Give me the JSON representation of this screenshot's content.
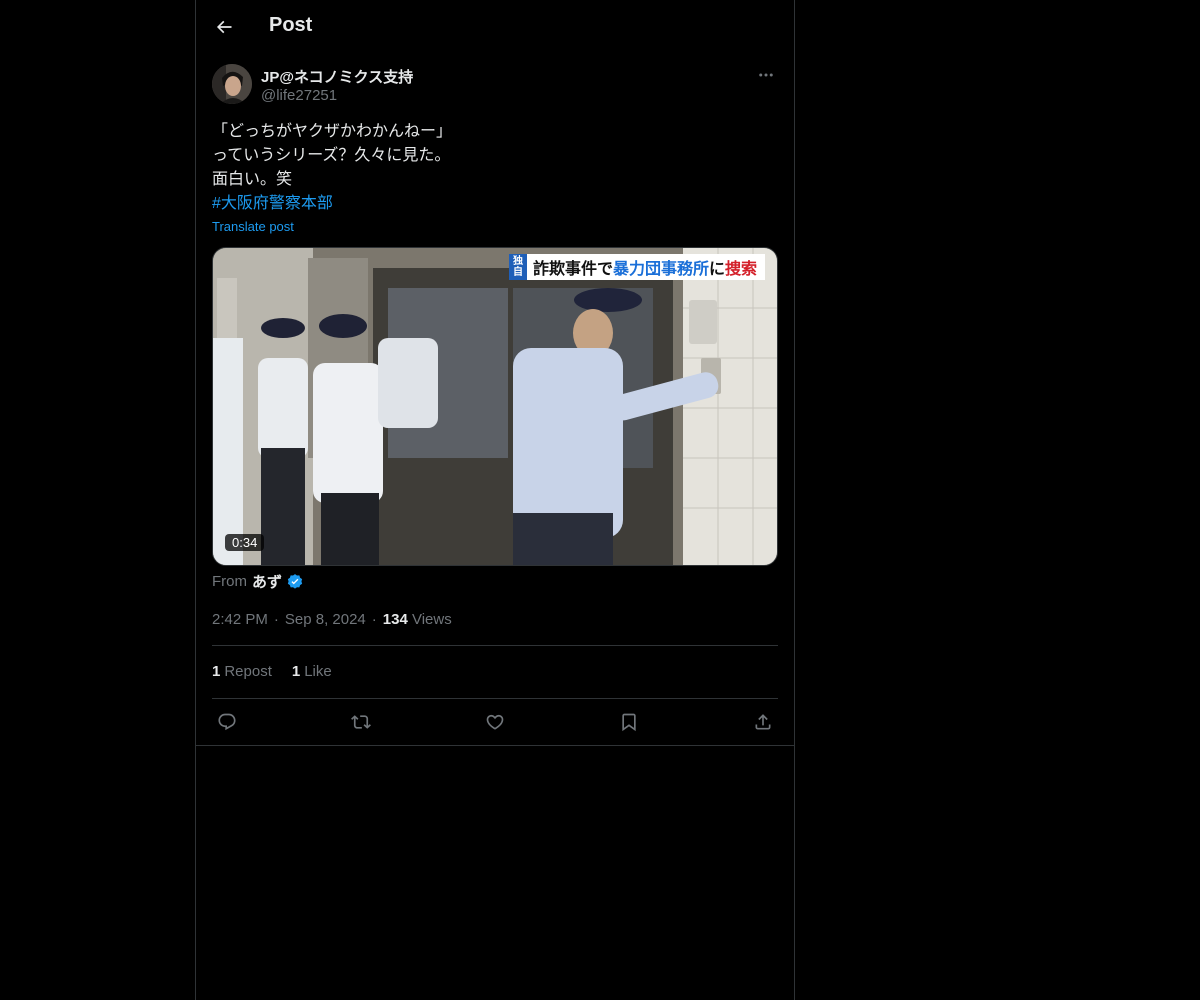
{
  "header": {
    "back_icon": "arrow-left-icon",
    "title": "Post"
  },
  "author": {
    "display_name": "JP@ネコノミクス支持",
    "handle": "@life27251",
    "more_icon": "more-horizontal-icon"
  },
  "post": {
    "lines": [
      "「どっちがヤクザかわかんねー」",
      "っていうシリーズ？久々に見た。",
      "面白い。笑"
    ],
    "hashtag": "#大阪府警察本部",
    "translate_label": "Translate post"
  },
  "media": {
    "caption_tag": [
      "独",
      "自"
    ],
    "caption_part1": "詐欺事件で",
    "caption_part2": "暴力団事務所",
    "caption_part3": "に",
    "caption_part4": "捜索",
    "duration": "0:34"
  },
  "attribution": {
    "from_label": "From",
    "source_name": "あず",
    "verified_icon": "verified-badge-icon"
  },
  "meta": {
    "time": "2:42 PM",
    "date": "Sep 8, 2024",
    "views_count": "134",
    "views_label": "Views"
  },
  "stats": {
    "reposts_count": "1",
    "reposts_label": "Repost",
    "likes_count": "1",
    "likes_label": "Like"
  },
  "actions": {
    "reply_icon": "reply-icon",
    "repost_icon": "repost-icon",
    "like_icon": "heart-icon",
    "bookmark_icon": "bookmark-icon",
    "share_icon": "share-icon"
  },
  "colors": {
    "accent": "#1d9bf0",
    "background": "#000000",
    "border": "#2f3336",
    "muted": "#71767b"
  }
}
